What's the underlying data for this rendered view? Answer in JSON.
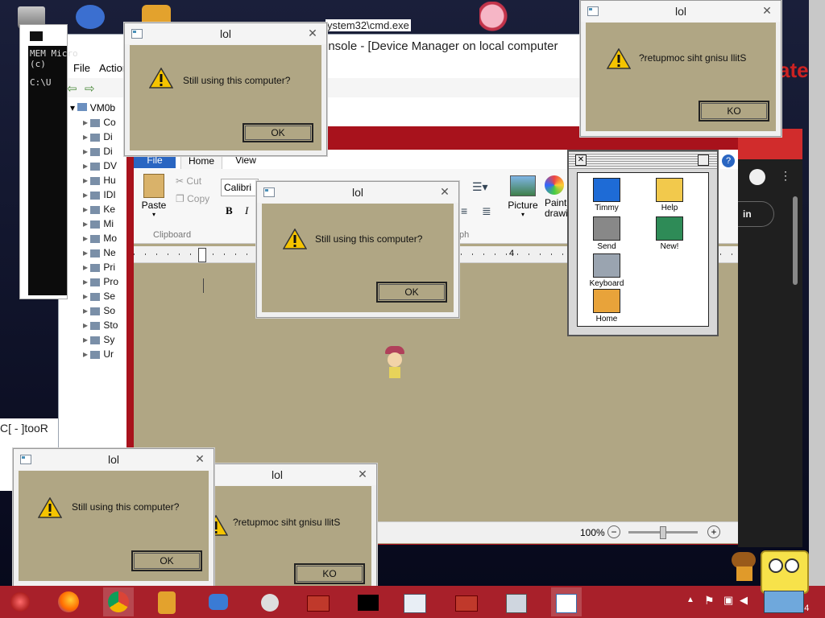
{
  "dialogs": {
    "d1": {
      "title": "lol",
      "message": "Still using this computer?",
      "ok": "OK",
      "close": "✕"
    },
    "d2": {
      "title": "lol",
      "message": "Still using this computer?",
      "ok": "OK",
      "close": "✕"
    },
    "d3": {
      "title": "lol",
      "message": "?retupmoc siht gnisu llitS",
      "ok": "KO",
      "close": "✕"
    },
    "d4": {
      "title": "lol",
      "message": "Still using this computer?",
      "ok": "OK",
      "close": "✕"
    },
    "d5": {
      "title": "lol",
      "message": "?retupmoc siht gnisu llitS",
      "ok": "KO",
      "close": "✕"
    }
  },
  "device_manager": {
    "title_fragment": "onsole - [Device Manager on local computer",
    "cmd_fragment": "ystem32\\cmd.exe",
    "menu": [
      "File",
      "Action"
    ],
    "root": "VM0b",
    "items": [
      "Co",
      "Di",
      "Di",
      "DV",
      "Hu",
      "IDI",
      "Ke",
      "Mi",
      "Mo",
      "Ne",
      "Pri",
      "Pro",
      "Se",
      "So",
      "Sto",
      "Sy",
      "Ur"
    ]
  },
  "cmd": {
    "lines": [
      "MEM Micro",
      "(c)",
      "C:\\U"
    ]
  },
  "wordpad": {
    "tabs": [
      "File",
      "Home",
      "View"
    ],
    "paste": "Paste",
    "cut": "Cut",
    "copy": "Copy",
    "clipboard": "Clipboard",
    "font": "Calibri",
    "bold": "B",
    "italic": "I",
    "picture": "Picture",
    "paint": "Paint drawing",
    "ruler_num": "4",
    "zoom": "100%",
    "ph": "ph"
  },
  "mac_window": {
    "icons": [
      {
        "name": "timmy-icon",
        "label": "Timmy"
      },
      {
        "name": "help-icon",
        "label": "Help"
      },
      {
        "name": "send-icon",
        "label": "Send"
      },
      {
        "name": "new-icon",
        "label": "New!"
      },
      {
        "name": "keyboard-icon",
        "label": "Keyboard"
      },
      {
        "name": "home-icon",
        "label": "Home"
      }
    ]
  },
  "chrome": {
    "signin": "in",
    "ate": "ate"
  },
  "left_fragment": "C[ - ]tooR",
  "clock": "024",
  "colors": {
    "dialog_bg": "#b0a684",
    "taskbar": "#a8202a",
    "wordpad_frame": "#a8121c"
  }
}
